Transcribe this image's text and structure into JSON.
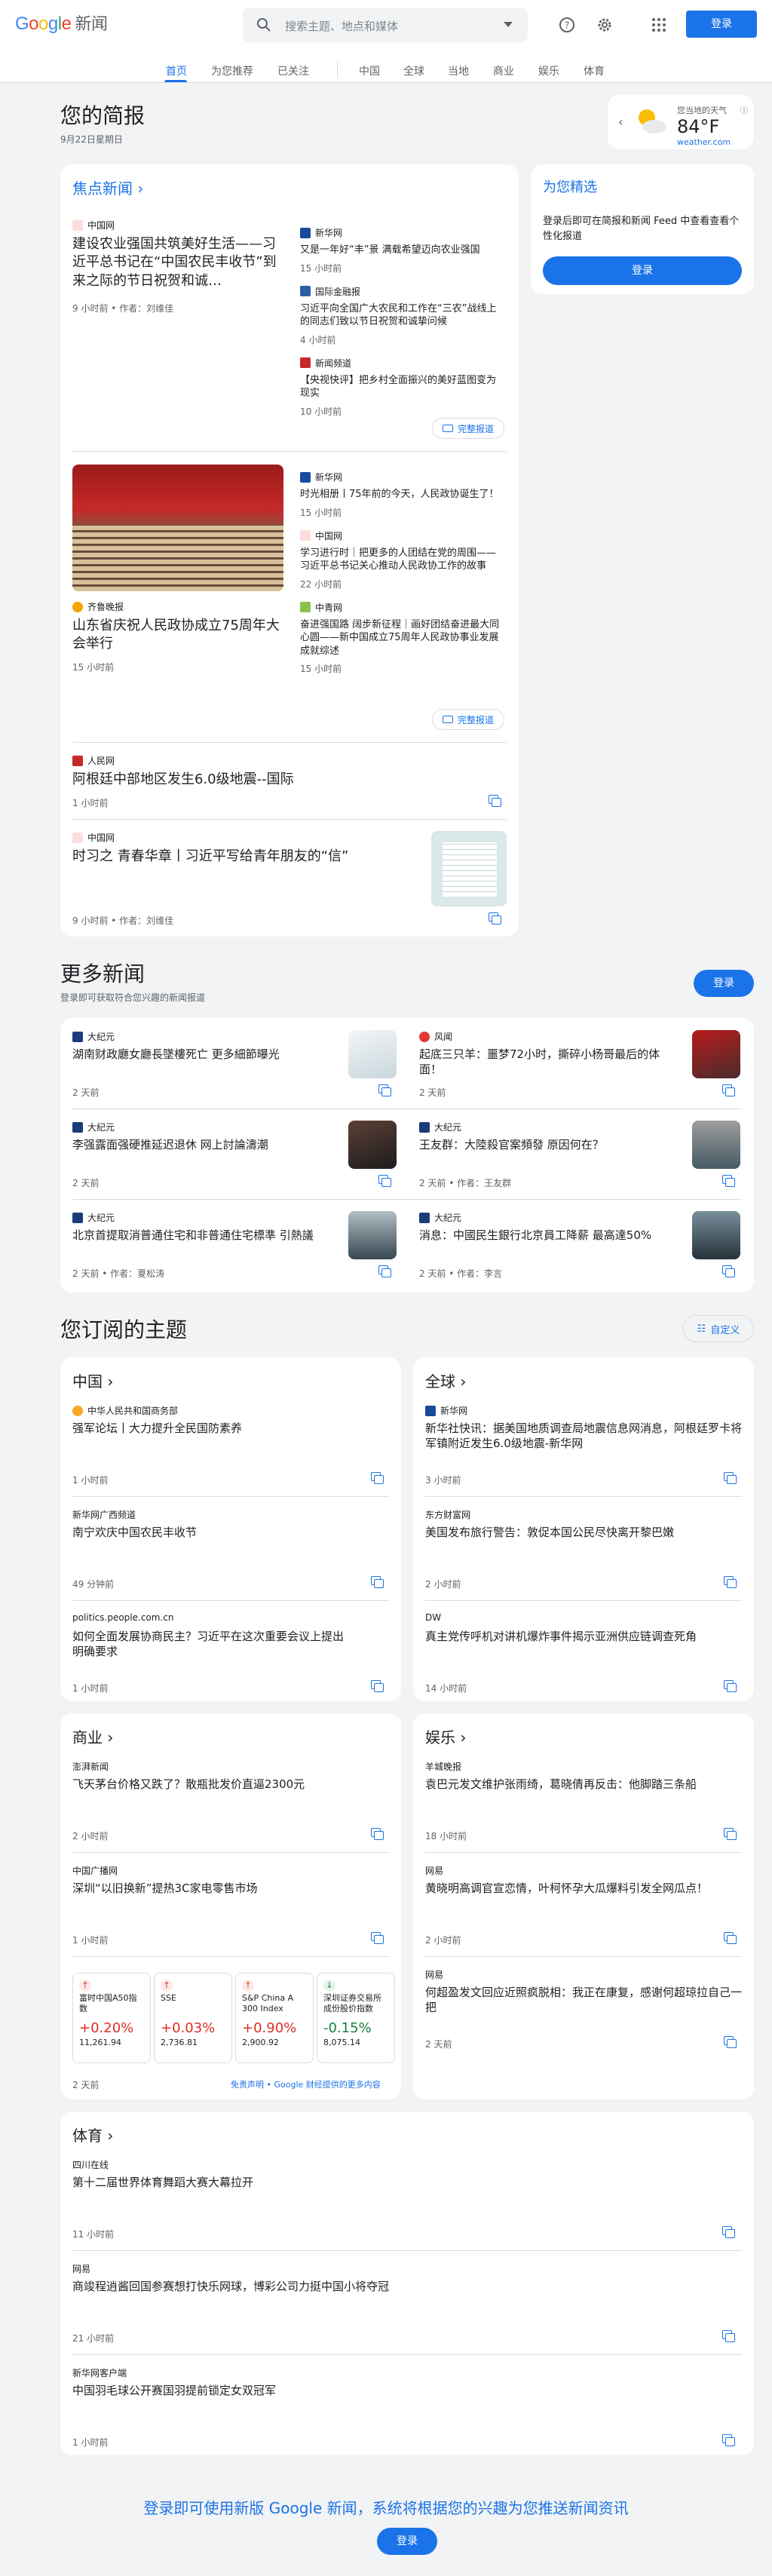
{
  "header": {
    "logo_google": "Google",
    "logo_news": "新闻",
    "search_placeholder": "搜索主题、地点和媒体",
    "signin": "登录"
  },
  "nav": [
    "首页",
    "为您推荐",
    "已关注",
    "中国",
    "全球",
    "当地",
    "商业",
    "娱乐",
    "体育"
  ],
  "briefing": {
    "title": "您的简报",
    "date": "9月22日星期日"
  },
  "weather": {
    "label": "您当地的天气",
    "temp": "84°F",
    "source": "weather.com"
  },
  "top": {
    "heading": "焦点新闻",
    "s1": {
      "source": "中国网",
      "title": "建设农业强国共筑美好生活——习近平总书记在“中国农民丰收节”到来之际的节日祝贺和诚…",
      "meta": "9 小时前 • 作者：刘维佳",
      "side": [
        {
          "source": "新华网",
          "title": "又是一年好“丰”景 满载希望迈向农业强国",
          "time": "15 小时前"
        },
        {
          "source": "国际金融报",
          "title": "习近平向全国广大农民和工作在“三农”战线上的同志们致以节日祝贺和诚挚问候",
          "time": "4 小时前"
        },
        {
          "source": "新闻频道",
          "title": "【央视快评】把乡村全面振兴的美好蓝图变为现实",
          "time": "10 小时前"
        }
      ],
      "full": "完整报道"
    },
    "s2": {
      "source": "齐鲁晚报",
      "title": "山东省庆祝人民政协成立75周年大会举行",
      "time": "15 小时前",
      "side": [
        {
          "source": "新华网",
          "title": "时光相册丨75年前的今天，人民政协诞生了！",
          "time": "15 小时前"
        },
        {
          "source": "中国网",
          "title": "学习进行时｜把更多的人团结在党的周围——习近平总书记关心推动人民政协工作的故事",
          "time": "22 小时前"
        },
        {
          "source": "中青网",
          "title": "奋进强国路 阔步新征程｜画好团结奋进最大同心圆——新中国成立75周年人民政协事业发展成就综述",
          "time": "15 小时前"
        }
      ],
      "full": "完整报道"
    },
    "s3": {
      "source": "人民网",
      "title": "阿根廷中部地区发生6.0级地震--国际",
      "time": "1 小时前"
    },
    "s4": {
      "source": "中国网",
      "title": "时习之 青春华章丨习近平写给青年朋友的“信”",
      "meta": "9 小时前 • 作者：刘维佳"
    }
  },
  "foryou": {
    "title": "为您精选",
    "text": "登录后即可在简报和新闻 Feed 中查看查看个性化报道",
    "button": "登录"
  },
  "more": {
    "title": "更多新闻",
    "subtitle": "登录即可获取符合您兴趣的新闻报道",
    "button": "登录",
    "items": [
      {
        "source": "大纪元",
        "title": "湖南财政廳女廳長墜樓死亡 更多細節曝光",
        "meta": "2 天前"
      },
      {
        "source": "风闻",
        "title": "起底三只羊：噩梦72小时，撕碎小杨哥最后的体面！",
        "meta": "2 天前"
      },
      {
        "source": "大纪元",
        "title": "李强露面强硬推延迟退休 网上討論濤潮",
        "meta": "2 天前"
      },
      {
        "source": "大纪元",
        "title": "王友群：大陸殺官案頻發 原因何在？",
        "meta": "2 天前 • 作者：王友群"
      },
      {
        "source": "大纪元",
        "title": "北京首提取消普通住宅和非普通住宅標準 引熱議",
        "meta": "2 天前 • 作者：夏松涛"
      },
      {
        "source": "大纪元",
        "title": "消息：中國民生銀行北京員工降薪 最高達50%",
        "meta": "2 天前 • 作者：李言"
      }
    ]
  },
  "topics": {
    "title": "您订阅的主题",
    "customize": "自定义",
    "china": {
      "title": "中国",
      "items": [
        {
          "source": "中华人民共和国商务部",
          "title": "强军论坛丨大力提升全民国防素养",
          "time": "1 小时前"
        },
        {
          "source": "新华网广西频道",
          "title": "南宁欢庆中国农民丰收节",
          "time": "49 分钟前"
        },
        {
          "source": "politics.people.com.cn",
          "title": "如何全面发展协商民主？习近平在这次重要会议上提出明确要求",
          "time": "1 小时前"
        }
      ]
    },
    "world": {
      "title": "全球",
      "items": [
        {
          "source": "新华网",
          "title": "新华社快讯：据美国地质调查局地震信息网消息，阿根廷罗卡将军镇附近发生6.0级地震-新华网",
          "time": "3 小时前"
        },
        {
          "source": "东方财富网",
          "title": "美国发布旅行警告：敦促本国公民尽快离开黎巴嫩",
          "time": "2 小时前"
        },
        {
          "source": "DW",
          "title": "真主党传呼机对讲机爆炸事件揭示亚洲供应链调查死角",
          "time": "14 小时前"
        }
      ]
    },
    "business": {
      "title": "商业",
      "items": [
        {
          "source": "澎湃新闻",
          "title": "飞天茅台价格又跌了？散瓶批发价直逼2300元",
          "time": "2 小时前"
        },
        {
          "source": "中国广播网",
          "title": "深圳“以旧换新”提热3C家电零售市场",
          "time": "1 小时前"
        }
      ],
      "stocks": [
        {
          "name": "富时中国A50指数",
          "pct": "+0.20%",
          "val": "11,261.94"
        },
        {
          "name": "SSE",
          "pct": "+0.03%",
          "val": "2,736.81"
        },
        {
          "name": "S&P China A 300 Index (CNY)",
          "pct": "+0.90%",
          "val": "2,900.92"
        },
        {
          "name": "深圳证券交易所成份股价指数",
          "pct": "-0.15%",
          "val": "8,075.14"
        }
      ],
      "foot_time": "2 天前",
      "disclaimer": "免责声明 • Google 财经提供的更多内容"
    },
    "ent": {
      "title": "娱乐",
      "items": [
        {
          "source": "羊城晚报",
          "title": "袁巴元发文维护张雨绮，葛晓倩再反击：他脚踏三条船",
          "time": "18 小时前"
        },
        {
          "source": "网易",
          "title": "黄晓明高调官宣恋情，叶柯怀孕大瓜爆料引发全网瓜点！",
          "time": "2 小时前"
        },
        {
          "source": "网易",
          "title": "何超盈发文回应近照疯脱相：我正在康复，感谢何超琼拉自己一把",
          "time": "2 天前"
        }
      ]
    },
    "sports": {
      "title": "体育",
      "items": [
        {
          "source": "四川在线",
          "title": "第十二届世界体育舞蹈大赛大幕拉开",
          "time": "11 小时前"
        },
        {
          "source": "网易",
          "title": "商竣程逍酱回国参赛想打快乐网球，博彩公司力挺中国小将夺冠",
          "time": "21 小时前"
        },
        {
          "source": "新华网客户端",
          "title": "中国羽毛球公开赛国羽提前锁定女双冠军",
          "time": "1 小时前"
        }
      ]
    }
  },
  "footer": {
    "text": "登录即可使用新版 Google 新闻，系统将根据您的兴趣为您推送新闻资讯",
    "button": "登录"
  },
  "colors": {
    "accent": "#1a73e8",
    "up": "#d93025",
    "down": "#188038"
  }
}
